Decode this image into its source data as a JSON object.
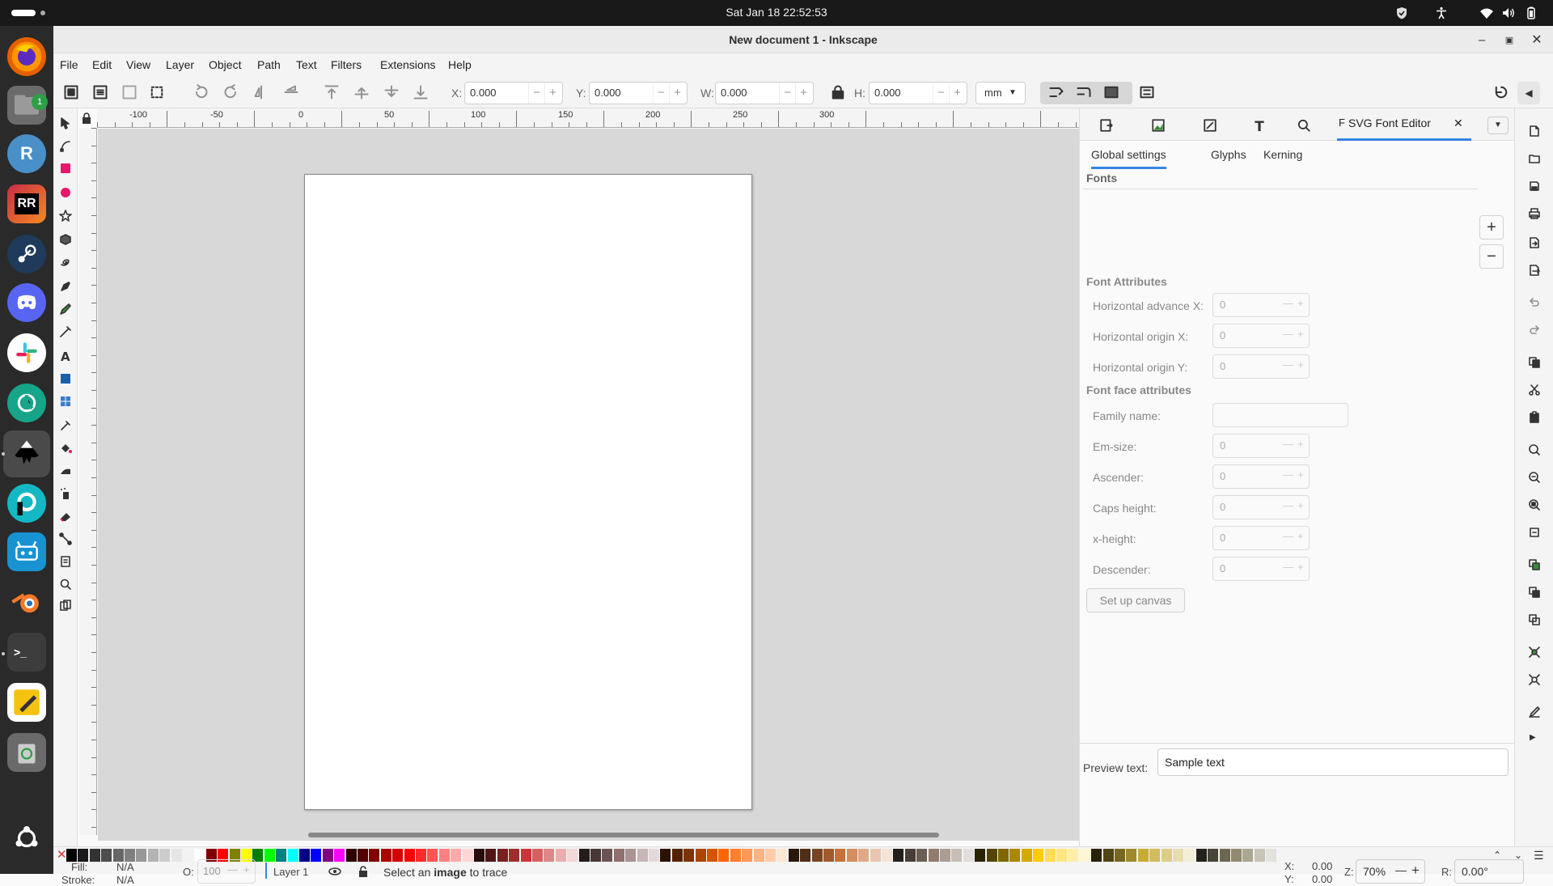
{
  "system": {
    "clock": "Sat Jan 18  22:52:53"
  },
  "dock": {
    "items": [
      {
        "name": "firefox",
        "glyph": "",
        "color": "#e66000"
      },
      {
        "name": "files",
        "glyph": "",
        "color": "#6b6b6b",
        "badge": "1"
      },
      {
        "name": "r-studio",
        "glyph": "R",
        "color": "#4a90c8"
      },
      {
        "name": "rustrover",
        "glyph": "RR",
        "color": "#c82c47"
      },
      {
        "name": "steam",
        "glyph": "",
        "color": "#1f3a5a"
      },
      {
        "name": "discord",
        "glyph": "",
        "color": "#5865f2"
      },
      {
        "name": "slack",
        "glyph": "",
        "color": "#ffffff"
      },
      {
        "name": "gitkraken",
        "glyph": "",
        "color": "#17a589"
      },
      {
        "name": "inkscape",
        "glyph": "",
        "color": "#3a3a3a"
      },
      {
        "name": "pycharm",
        "glyph": "",
        "color": "#14b8c4"
      },
      {
        "name": "bitwarden",
        "glyph": "",
        "color": "#1793d1"
      },
      {
        "name": "blender",
        "glyph": "",
        "color": "#f5792a"
      },
      {
        "name": "terminal",
        "glyph": ">_",
        "color": "#3c3c3c"
      },
      {
        "name": "text-editor",
        "glyph": "",
        "color": "#f5c211"
      },
      {
        "name": "trash",
        "glyph": "",
        "color": "#6a6a6a"
      },
      {
        "name": "ubuntu-apps",
        "glyph": "",
        "color": "#2a2a2a"
      }
    ]
  },
  "window": {
    "title": "New document 1 - Inkscape"
  },
  "menu": [
    "File",
    "Edit",
    "View",
    "Layer",
    "Object",
    "Path",
    "Text",
    "Filters",
    "Extensions",
    "Help"
  ],
  "toolbar": {
    "x_label": "X:",
    "x_value": "0.000",
    "y_label": "Y:",
    "y_value": "0.000",
    "w_label": "W:",
    "w_value": "0.000",
    "h_label": "H:",
    "h_value": "0.000",
    "unit": "mm"
  },
  "ruler": {
    "labels": [
      "-100",
      "-50",
      "0",
      "50",
      "100",
      "150",
      "200",
      "250",
      "300"
    ],
    "vlabels": [
      "0",
      "5\n0",
      "1\n0\n0",
      "1\n5\n0",
      "2\n0\n0",
      "2\n5\n0",
      "3"
    ]
  },
  "dialog": {
    "active_tab": "SVG Font Editor",
    "subtabs": [
      "Global settings",
      "Glyphs",
      "Kerning"
    ],
    "fonts_label": "Fonts",
    "font_attributes_heading": "Font Attributes",
    "font_face_heading": "Font face attributes",
    "attrs": [
      {
        "label": "Horizontal advance X:",
        "value": "0"
      },
      {
        "label": "Horizontal origin X:",
        "value": "0"
      },
      {
        "label": "Horizontal origin Y:",
        "value": "0"
      }
    ],
    "family_label": "Family name:",
    "family_value": "",
    "face": [
      {
        "label": "Em-size:",
        "value": "0"
      },
      {
        "label": "Ascender:",
        "value": "0"
      },
      {
        "label": "Caps height:",
        "value": "0"
      },
      {
        "label": "x-height:",
        "value": "0"
      },
      {
        "label": "Descender:",
        "value": "0"
      }
    ],
    "setup_button": "Set up canvas",
    "preview_label": "Preview text:",
    "preview_value": "Sample text"
  },
  "status": {
    "fill_label": "Fill:",
    "fill_value": "N/A",
    "stroke_label": "Stroke:",
    "stroke_value": "N/A",
    "opacity_label": "O:",
    "opacity_value": "100",
    "layer": "Layer 1",
    "message_pre": "Select an ",
    "message_bold": "image",
    "message_post": " to trace",
    "cx_label": "X:",
    "cx_value": "0.00",
    "cy_label": "Y:",
    "cy_value": "0.00",
    "zoom_label": "Z:",
    "zoom_value": "70%",
    "rot_label": "R:",
    "rot_value": "0.00°"
  },
  "palette": [
    "#000000",
    "#1a1a1a",
    "#333333",
    "#4d4d4d",
    "#666666",
    "#808080",
    "#999999",
    "#b3b3b3",
    "#cccccc",
    "#e6e6e6",
    "#f2f2f2",
    "#ffffff",
    "#800000",
    "#ff0000",
    "#808000",
    "#ffff00",
    "#008000",
    "#00ff00",
    "#008080",
    "#00ffff",
    "#000080",
    "#0000ff",
    "#800080",
    "#ff00ff",
    "#2b0000",
    "#550000",
    "#800000",
    "#aa0000",
    "#d40000",
    "#ff0000",
    "#ff2a2a",
    "#ff5555",
    "#ff8080",
    "#ffaaaa",
    "#ffd5d5",
    "#280b0b",
    "#501616",
    "#782121",
    "#a02c2c",
    "#c83737",
    "#d35f5f",
    "#de8787",
    "#e9afaf",
    "#f4d7d7",
    "#241c1c",
    "#483737",
    "#6c5353",
    "#916f6f",
    "#ac9393",
    "#c8b7b7",
    "#e3dbdb",
    "#2b1100",
    "#552200",
    "#803300",
    "#aa4400",
    "#d45500",
    "#ff6600",
    "#ff7f2a",
    "#ff9955",
    "#ffb380",
    "#ffccaa",
    "#ffe6d5",
    "#28170b",
    "#502d16",
    "#784421",
    "#a05a2c",
    "#c87137",
    "#d38d5f",
    "#deaa87",
    "#e9c6af",
    "#f4e3d7",
    "#241f1c",
    "#483e37",
    "#6c5d53",
    "#917c6f",
    "#ac9d93",
    "#c8beb7",
    "#e3dedb",
    "#2b2200",
    "#554400",
    "#806600",
    "#aa8800",
    "#d4aa00",
    "#ffcc00",
    "#ffdd55",
    "#ffe680",
    "#ffeeaa",
    "#fff6d5",
    "#28220b",
    "#504416",
    "#786721",
    "#a0892c",
    "#c8ab37",
    "#d3bc5f",
    "#decd87",
    "#e9ddaf",
    "#f4eed7",
    "#24221c",
    "#484537",
    "#6c6753",
    "#918a6f",
    "#aca793",
    "#c8c4b7",
    "#e3e2db"
  ]
}
